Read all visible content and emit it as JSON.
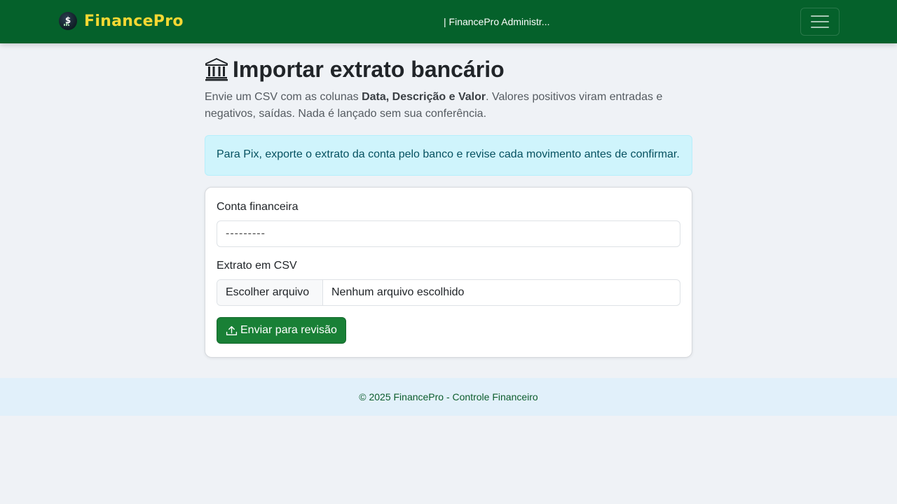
{
  "navbar": {
    "brand_icon": "dollar-chart-logo-icon",
    "brand_text": "FinancePro",
    "user_text": "| FinancePro Administr...",
    "toggler_icon": "hamburger-menu-icon"
  },
  "main": {
    "title_icon": "bank-building-icon",
    "title": "Importar extrato bancário",
    "lead_prefix": "Envie um CSV com as colunas ",
    "lead_bold": "Data, Descrição e Valor",
    "lead_suffix": ". Valores positivos viram entradas e negativos, saídas. Nada é lançado sem sua conferência.",
    "alert_text": "Para Pix, exporte o extrato da conta pelo banco e revise cada movimento antes de confirmar."
  },
  "form": {
    "account_label": "Conta financeira",
    "account_value": "---------",
    "csv_label": "Extrato em CSV",
    "file_button": "Escolher arquivo",
    "file_status": "Nenhum arquivo escolhido",
    "submit_icon": "upload-icon",
    "submit_label": "Enviar para revisão"
  },
  "footer": {
    "text": "© 2025 FinancePro - Controle Financeiro"
  },
  "colors": {
    "navbar_bg": "#05612b",
    "brand_text": "#f5d833",
    "submit_bg": "#198036",
    "alert_bg": "#cff4fc",
    "footer_bg": "#e1f0fa"
  }
}
